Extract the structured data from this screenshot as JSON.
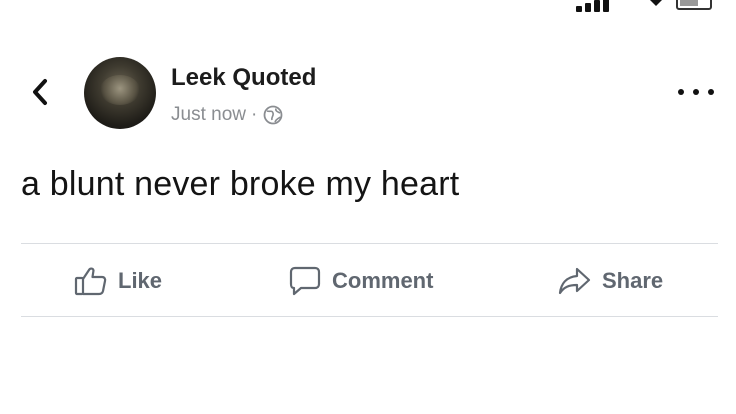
{
  "post": {
    "author": "Leek Quoted",
    "timestamp": "Just now",
    "separator": "·",
    "privacy_icon": "globe-icon",
    "text": "a blunt never broke my heart"
  },
  "actions": {
    "like_label": "Like",
    "comment_label": "Comment",
    "share_label": "Share"
  },
  "icons": {
    "back": "chevron-left-icon",
    "more": "more-horizontal-icon",
    "like": "thumbs-up-icon",
    "comment": "speech-bubble-icon",
    "share": "share-arrow-icon"
  },
  "colors": {
    "text_primary": "#141414",
    "text_secondary": "#8a8d91",
    "action_text": "#606770",
    "divider": "#dadde1"
  }
}
